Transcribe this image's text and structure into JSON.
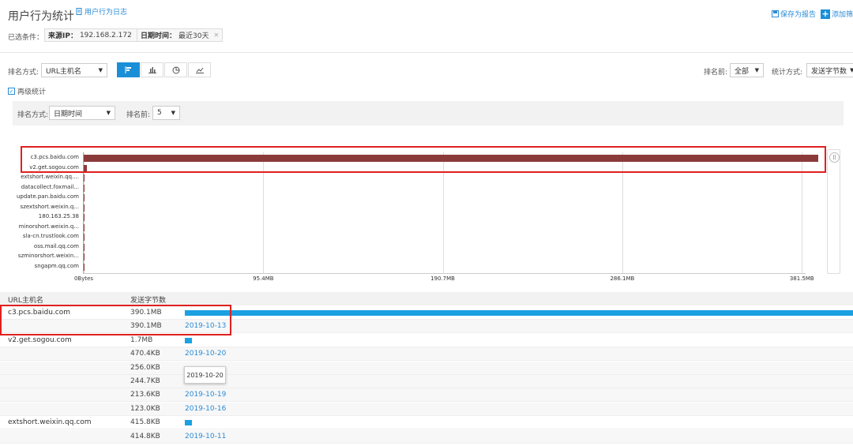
{
  "header": {
    "title": "用户行为统计",
    "log_link": "用户行为日志",
    "save_report": "保存为报告",
    "add_filter": "添加筛"
  },
  "filters": {
    "label": "已选条件：",
    "chips": [
      {
        "key": "来源IP：",
        "value": "192.168.2.172"
      },
      {
        "key": "日期时间：",
        "value": "最近30天"
      }
    ]
  },
  "toolbar": {
    "sort_label": "排名方式:",
    "sort_value": "URL主机名",
    "top_label": "排名前:",
    "top_value": "全部",
    "stat_label": "统计方式:",
    "stat_value": "发送字节数"
  },
  "drill": {
    "label": "再级统计",
    "sort_label": "排名方式:",
    "sort_value": "日期时间",
    "top_label": "排名前:",
    "top_value": "5"
  },
  "chart_data": {
    "type": "bar",
    "orientation": "horizontal",
    "categories": [
      "c3.pcs.baidu.com",
      "v2.get.sogou.com",
      "extshort.weixin.qq....",
      "datacollect.foxmail...",
      "update.pan.baidu.com",
      "szextshort.weixin.q...",
      "180.163.25.38",
      "minorshort.weixin.q...",
      "sla-cn.trustlook.com",
      "oss.mail.qq.com",
      "szminorshort.weixin...",
      "sngapm.qq.com"
    ],
    "values_mb": [
      390.1,
      1.7,
      0.41,
      0.2,
      0.15,
      0.1,
      0.08,
      0.06,
      0.05,
      0.04,
      0.03,
      0.02
    ],
    "x_ticks": [
      "0Bytes",
      "95.4MB",
      "190.7MB",
      "286.1MB",
      "381.5MB"
    ],
    "x_tick_values_mb": [
      0,
      95.4,
      190.7,
      286.1,
      381.5
    ],
    "bar_color": "#8b3a3a",
    "grid": true
  },
  "table": {
    "headers": [
      "URL主机名",
      "发送字节数"
    ],
    "rows": [
      {
        "host": "c3.pcs.baidu.com",
        "value": "390.1MB",
        "bar_fraction": 1.0,
        "type": "main"
      },
      {
        "host": "",
        "value": "390.1MB",
        "date": "2019-10-13",
        "type": "sub"
      },
      {
        "host": "v2.get.sogou.com",
        "value": "1.7MB",
        "bar_fraction": 0.011,
        "type": "main"
      },
      {
        "host": "",
        "value": "470.4KB",
        "date": "2019-10-20",
        "type": "sub"
      },
      {
        "host": "",
        "value": "256.0KB",
        "date": "",
        "type": "sub"
      },
      {
        "host": "",
        "value": "244.7KB",
        "date": "2019-10-15",
        "type": "sub"
      },
      {
        "host": "",
        "value": "213.6KB",
        "date": "2019-10-19",
        "type": "sub"
      },
      {
        "host": "",
        "value": "123.0KB",
        "date": "2019-10-16",
        "type": "sub"
      },
      {
        "host": "extshort.weixin.qq.com",
        "value": "415.8KB",
        "bar_fraction": 0.011,
        "type": "main"
      },
      {
        "host": "",
        "value": "414.8KB",
        "date": "2019-10-11",
        "type": "sub"
      }
    ],
    "tooltip": "2019-10-20"
  }
}
